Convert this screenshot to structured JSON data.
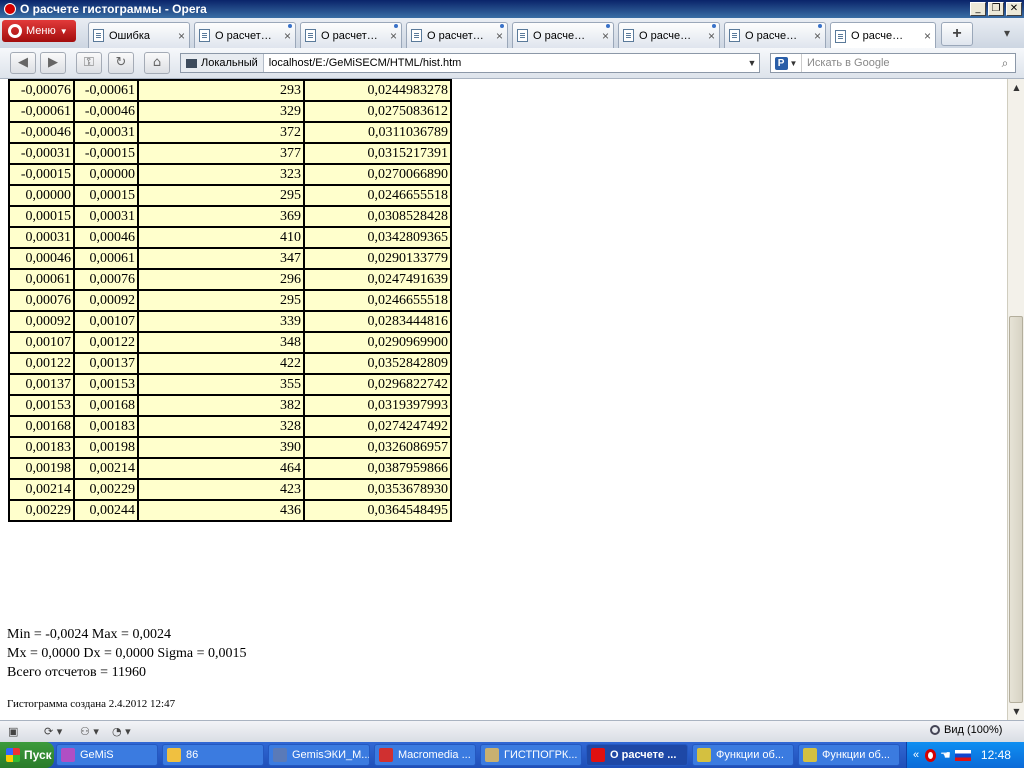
{
  "window": {
    "title": "О расчете гистограммы - Opera",
    "buttons": [
      "_",
      "❐",
      "✕"
    ]
  },
  "menu_label": "Меню",
  "tabs": [
    {
      "label": "Ошибка",
      "close": "×"
    },
    {
      "label": "О расчет…",
      "close": "×"
    },
    {
      "label": "О расчет…",
      "close": "×"
    },
    {
      "label": "О расчет…",
      "close": "×"
    },
    {
      "label": "О расче…",
      "close": "×"
    },
    {
      "label": "О расче…",
      "close": "×"
    },
    {
      "label": "О расче…",
      "close": "×"
    },
    {
      "label": "О расче…",
      "close": "×"
    }
  ],
  "address": {
    "zone": "Локальный",
    "url": "localhost/E:/GeMiSECM/HTML/hist.htm"
  },
  "search": {
    "placeholder": "Искать в Google"
  },
  "table_rows": [
    [
      "-0,00076",
      "-0,00061",
      "293",
      "0,0244983278"
    ],
    [
      "-0,00061",
      "-0,00046",
      "329",
      "0,0275083612"
    ],
    [
      "-0,00046",
      "-0,00031",
      "372",
      "0,0311036789"
    ],
    [
      "-0,00031",
      "-0,00015",
      "377",
      "0,0315217391"
    ],
    [
      "-0,00015",
      "0,00000",
      "323",
      "0,0270066890"
    ],
    [
      "0,00000",
      "0,00015",
      "295",
      "0,0246655518"
    ],
    [
      "0,00015",
      "0,00031",
      "369",
      "0,0308528428"
    ],
    [
      "0,00031",
      "0,00046",
      "410",
      "0,0342809365"
    ],
    [
      "0,00046",
      "0,00061",
      "347",
      "0,0290133779"
    ],
    [
      "0,00061",
      "0,00076",
      "296",
      "0,0247491639"
    ],
    [
      "0,00076",
      "0,00092",
      "295",
      "0,0246655518"
    ],
    [
      "0,00092",
      "0,00107",
      "339",
      "0,0283444816"
    ],
    [
      "0,00107",
      "0,00122",
      "348",
      "0,0290969900"
    ],
    [
      "0,00122",
      "0,00137",
      "422",
      "0,0352842809"
    ],
    [
      "0,00137",
      "0,00153",
      "355",
      "0,0296822742"
    ],
    [
      "0,00153",
      "0,00168",
      "382",
      "0,0319397993"
    ],
    [
      "0,00168",
      "0,00183",
      "328",
      "0,0274247492"
    ],
    [
      "0,00183",
      "0,00198",
      "390",
      "0,0326086957"
    ],
    [
      "0,00198",
      "0,00214",
      "464",
      "0,0387959866"
    ],
    [
      "0,00214",
      "0,00229",
      "423",
      "0,0353678930"
    ],
    [
      "0,00229",
      "0,00244",
      "436",
      "0,0364548495"
    ]
  ],
  "stats": {
    "line1": "Min = -0,0024 Max = 0,0024",
    "line2": "Mx = 0,0000 Dx = 0,0000 Sigma = 0,0015",
    "line3": "Всего отсчетов = 11960",
    "created": "Гистограмма создана 2.4.2012 12:47"
  },
  "status": {
    "zoom": "Вид (100%)"
  },
  "taskbar": {
    "start": "Пуск",
    "items": [
      {
        "label": "GeMiS",
        "color": "#b04fc4"
      },
      {
        "label": "86",
        "color": "#f0c040"
      },
      {
        "label": "GemisЭКИ_М...",
        "color": "#5a7ab8"
      },
      {
        "label": "Macromedia ...",
        "color": "#d03030"
      },
      {
        "label": "ГИСТПОГРК...",
        "color": "#c8b070"
      },
      {
        "label": "О расчете ...",
        "color": "#e01010"
      },
      {
        "label": "Функции об...",
        "color": "#d4c040"
      },
      {
        "label": "Функции об...",
        "color": "#d4c040"
      }
    ],
    "tray_chevron": "«",
    "clock": "12:48"
  }
}
